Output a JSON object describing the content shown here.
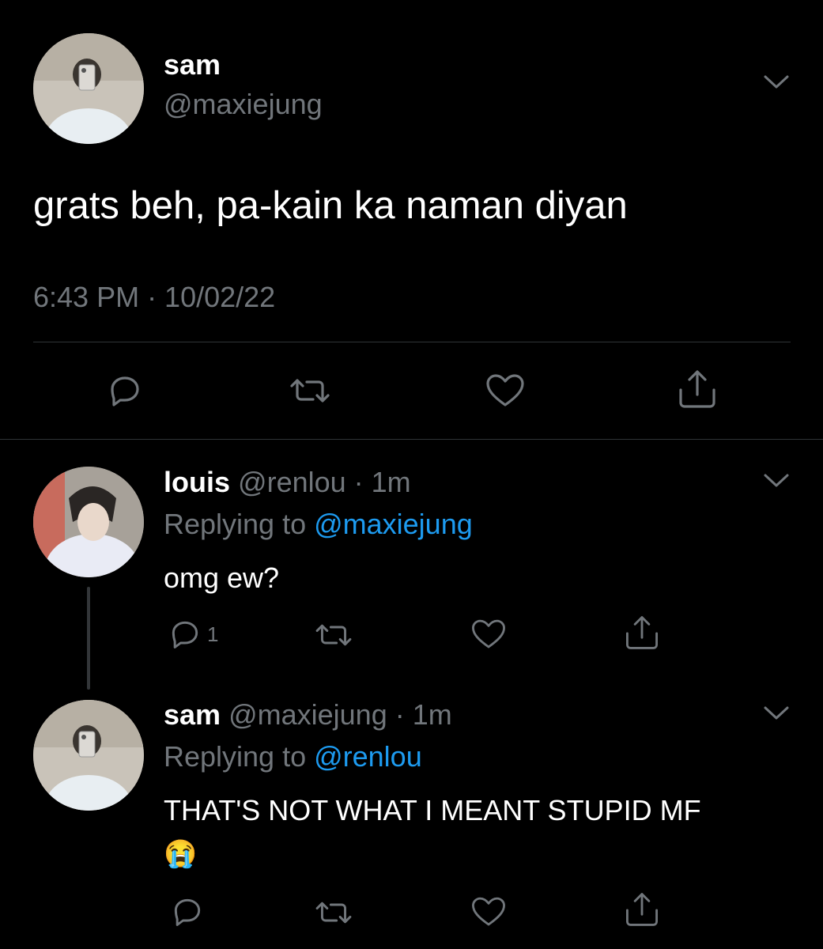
{
  "main_tweet": {
    "display_name": "sam",
    "handle": "@maxiejung",
    "text": "grats beh, pa-kain ka naman diyan",
    "timestamp": "6:43 PM · 10/02/22",
    "avatar_icon": "avatar-photo-icon"
  },
  "replies": [
    {
      "display_name": "louis",
      "handle_time": "@renlou · 1m",
      "replying_prefix": "Replying to ",
      "replying_handle": "@maxiejung",
      "text": "omg ew?",
      "reply_count": "1"
    },
    {
      "display_name": "sam",
      "handle_time": "@maxiejung · 1m",
      "replying_prefix": "Replying to ",
      "replying_handle": "@renlou",
      "text": "THAT'S NOT WHAT I MEANT STUPID MF",
      "emoji": "😭"
    }
  ],
  "icons": {
    "reply": "reply-icon",
    "retweet": "retweet-icon",
    "like": "heart-icon",
    "share": "share-icon",
    "more": "chevron-down-icon"
  },
  "colors": {
    "background": "#000000",
    "text": "#ffffff",
    "muted": "#71767b",
    "link": "#1d9bf0",
    "divider": "#2f3336"
  }
}
